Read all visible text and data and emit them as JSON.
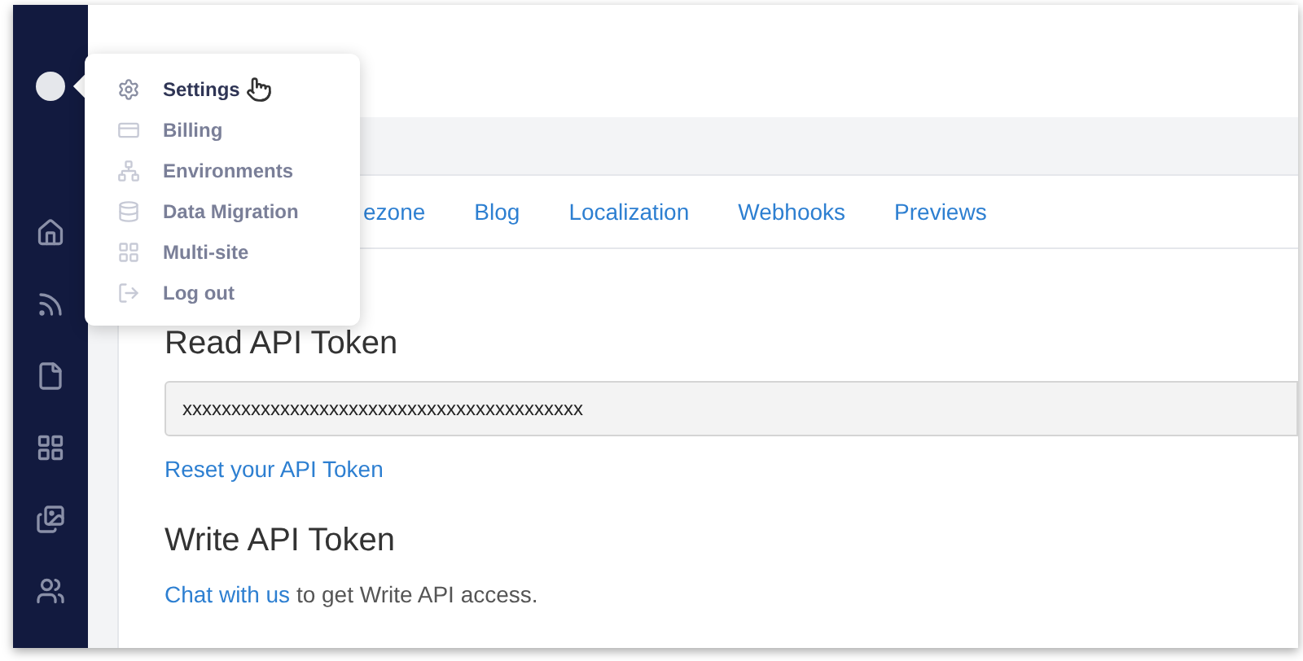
{
  "sidebar": {
    "items": [
      {
        "kind": "home"
      },
      {
        "kind": "feed"
      },
      {
        "kind": "file"
      },
      {
        "kind": "grid"
      },
      {
        "kind": "images"
      },
      {
        "kind": "users"
      }
    ]
  },
  "account_menu": {
    "items": [
      {
        "label": "Settings",
        "kind": "settings",
        "selected": true
      },
      {
        "label": "Billing",
        "kind": "billing",
        "selected": false
      },
      {
        "label": "Environments",
        "kind": "environments",
        "selected": false
      },
      {
        "label": "Data Migration",
        "kind": "migration",
        "selected": false
      },
      {
        "label": "Multi-site",
        "kind": "multisite",
        "selected": false
      },
      {
        "label": "Log out",
        "kind": "logout",
        "selected": false
      }
    ]
  },
  "tabs": [
    {
      "label": "ezone"
    },
    {
      "label": "Blog"
    },
    {
      "label": "Localization"
    },
    {
      "label": "Webhooks"
    },
    {
      "label": "Previews"
    }
  ],
  "read_token": {
    "title": "Read API Token",
    "value": "xxxxxxxxxxxxxxxxxxxxxxxxxxxxxxxxxxxxxxxxx",
    "reset_link": "Reset your API Token"
  },
  "write_token": {
    "title": "Write API Token",
    "link": "Chat with us",
    "text": "to get Write API access."
  }
}
